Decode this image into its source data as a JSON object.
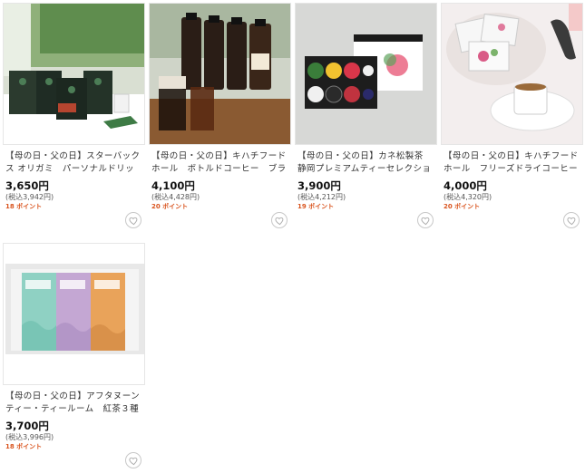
{
  "products": [
    {
      "title": "【母の日・父の日】スターバックス オリガミ　パーソナルドリップ　…",
      "price": "3,650円",
      "tax_included": "(税込3,942円)",
      "points": "18 ポイント",
      "image": "starbucks-origami-drip-set"
    },
    {
      "title": "【母の日・父の日】キハチフードホール　ボトルドコーヒー　ブラッ…",
      "price": "4,100円",
      "tax_included": "(税込4,428円)",
      "points": "20 ポイント",
      "image": "kihachi-bottled-coffee"
    },
    {
      "title": "【母の日・父の日】カネ松製茶　静岡プレミアムティーセレクション…",
      "price": "3,900円",
      "tax_included": "(税込4,212円)",
      "points": "19 ポイント",
      "image": "kanematsu-premium-tea-selection"
    },
    {
      "title": "【母の日・父の日】キハチフードホール　フリーズドライコーヒーセ…",
      "price": "4,000円",
      "tax_included": "(税込4,320円)",
      "points": "20 ポイント",
      "image": "kihachi-freeze-dried-coffee"
    },
    {
      "title": "【母の日・父の日】アフタヌーンティー・ティールーム　紅茶３種詰…",
      "price": "3,700円",
      "tax_included": "(税込3,996円)",
      "points": "18 ポイント",
      "image": "afternoon-tea-three-tea-set"
    }
  ],
  "colors": {
    "points": "#d9541e",
    "border": "#e6e6e6"
  }
}
